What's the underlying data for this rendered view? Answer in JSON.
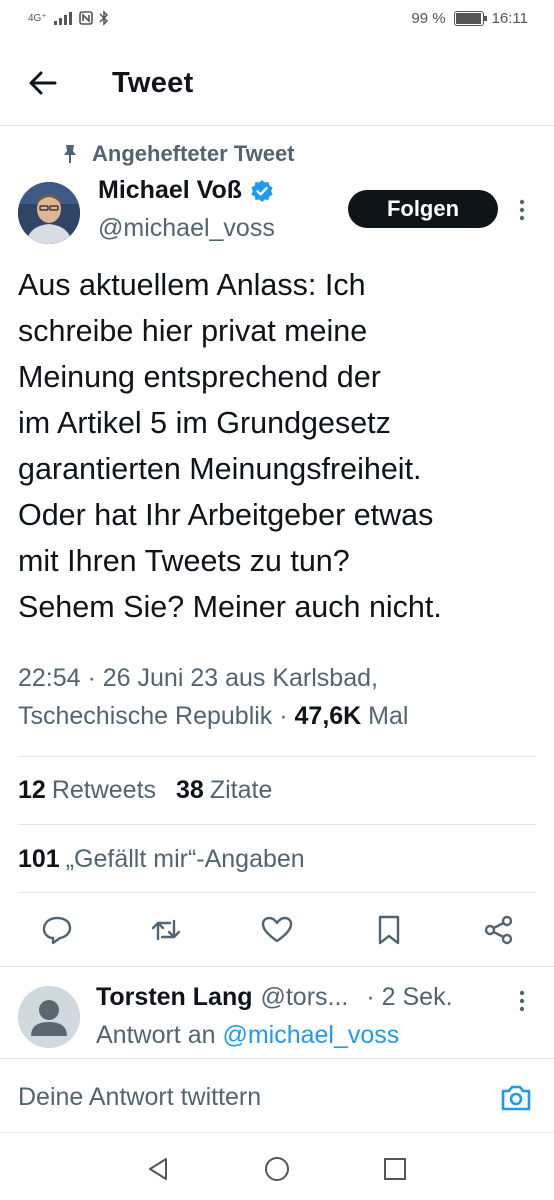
{
  "status_bar": {
    "network": "4G⁺",
    "battery_text": "99 %",
    "battery_level": 0.99,
    "time": "16:11"
  },
  "header": {
    "back_icon": "arrow-left-icon",
    "title": "Tweet"
  },
  "tweet": {
    "pinned_label": "Angehefteter Tweet",
    "author_name": "Michael Voß",
    "author_handle": "@michael_voss",
    "verified_color": "#1d9bf0",
    "follow_label": "Folgen",
    "text": "Aus aktuellem Anlass: Ich\nschreibe hier privat meine\nMeinung entsprechend der\nim Artikel 5 im Grundgesetz\ngarantierten Meinungsfreiheit.\nOder hat Ihr Arbeitgeber etwas\nmit Ihren Tweets zu tun?\nSehem Sie? Meiner auch nicht.",
    "meta_line1": "22:54 · 26 Juni 23 aus Karlsbad,",
    "meta_line2_prefix": "Tschechische Republik · ",
    "views_count": "47,6K",
    "views_label": " Mal",
    "retweets_count": "12",
    "retweets_label": "Retweets",
    "quotes_count": "38",
    "quotes_label": "Zitate",
    "likes_count": "101",
    "likes_label": "„Gefällt mir“-Angaben"
  },
  "actions": [
    "reply-icon",
    "retweet-icon",
    "like-icon",
    "bookmark-icon",
    "share-icon"
  ],
  "reply": {
    "name": "Torsten Lang",
    "handle": "@tors...",
    "time": "· 2 Sek.",
    "reply_to_prefix": "Antwort an ",
    "reply_to_handle": "@michael_voss"
  },
  "compose": {
    "placeholder": "Deine Antwort twittern"
  },
  "colors": {
    "accent": "#1d9bf0",
    "text": "#0f1419",
    "secondary": "#536471"
  }
}
